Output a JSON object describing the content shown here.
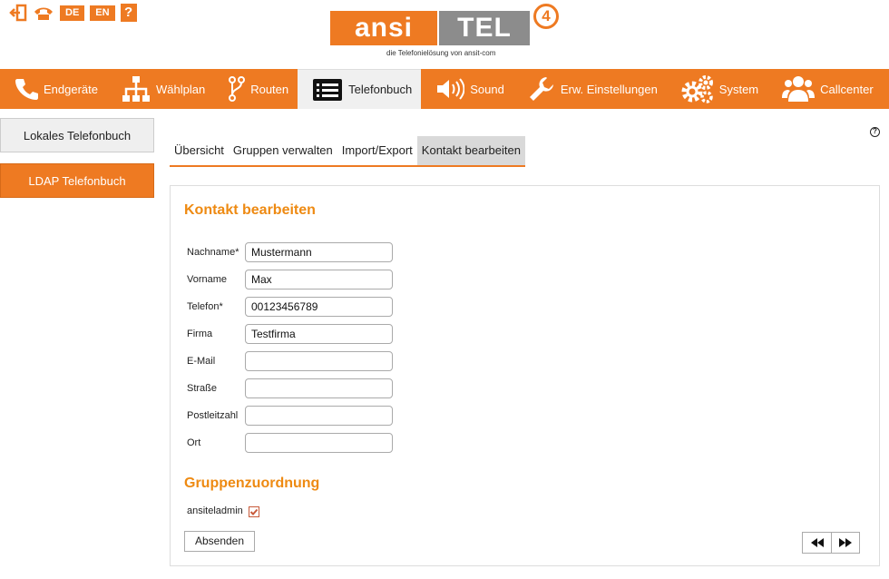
{
  "header": {
    "lang_de": "DE",
    "lang_en": "EN",
    "help": "?",
    "logo_left": "ansi",
    "logo_right": "TEL",
    "logo_version": "4",
    "logo_tagline": "die Telefonielösung von ansit-com",
    "icons": [
      "logout-icon",
      "phone-icon"
    ]
  },
  "nav": {
    "items": [
      {
        "label": "Endgeräte",
        "icon": "phone-icon"
      },
      {
        "label": "Wählplan",
        "icon": "sitemap-icon"
      },
      {
        "label": "Routen",
        "icon": "route-icon"
      },
      {
        "label": "Telefonbuch",
        "icon": "list-icon"
      },
      {
        "label": "Sound",
        "icon": "speaker-icon"
      },
      {
        "label": "Erw. Einstellungen",
        "icon": "wrench-icon"
      },
      {
        "label": "System",
        "icon": "gears-icon"
      },
      {
        "label": "Callcenter",
        "icon": "users-icon"
      }
    ],
    "active": "Telefonbuch"
  },
  "sidebar": {
    "local": "Lokales Telefonbuch",
    "ldap": "LDAP Telefonbuch"
  },
  "subtabs": {
    "items": [
      "Übersicht",
      "Gruppen verwalten",
      "Import/Export",
      "Kontakt bearbeiten"
    ],
    "active": "Kontakt bearbeiten"
  },
  "form": {
    "title": "Kontakt bearbeiten",
    "fields": [
      {
        "label": "Nachname*",
        "value": "Mustermann"
      },
      {
        "label": "Vorname",
        "value": "Max"
      },
      {
        "label": "Telefon*",
        "value": "00123456789"
      },
      {
        "label": "Firma",
        "value": "Testfirma"
      },
      {
        "label": "E-Mail",
        "value": ""
      },
      {
        "label": "Straße",
        "value": ""
      },
      {
        "label": "Postleitzahl",
        "value": ""
      },
      {
        "label": "Ort",
        "value": ""
      }
    ],
    "group_title": "Gruppenzuordnung",
    "group_label": "ansiteladmin",
    "group_checked": true,
    "submit": "Absenden"
  },
  "colors": {
    "accent": "#ee7a22",
    "heading": "#ee8a12"
  }
}
